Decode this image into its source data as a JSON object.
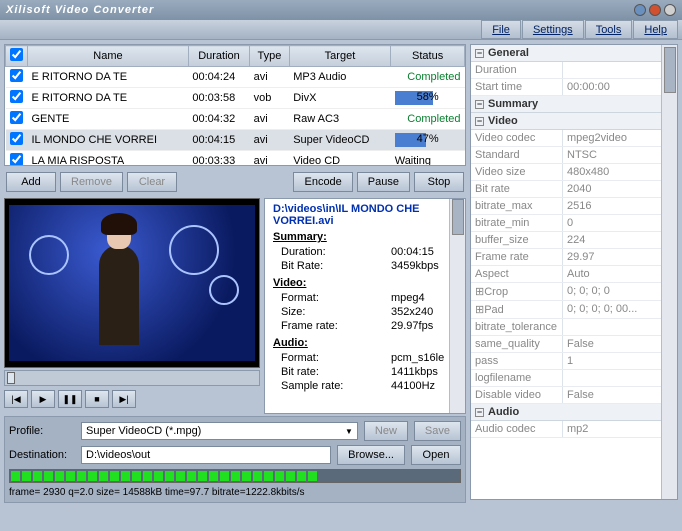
{
  "title": "Xilisoft Video Converter",
  "menu": [
    "File",
    "Settings",
    "Tools",
    "Help"
  ],
  "columns": [
    "Name",
    "Duration",
    "Type",
    "Target",
    "Status"
  ],
  "files": [
    {
      "name": "E RITORNO DA TE",
      "dur": "00:04:24",
      "type": "avi",
      "target": "MP3 Audio",
      "status": "Completed",
      "kind": "done"
    },
    {
      "name": "E RITORNO DA TE",
      "dur": "00:03:58",
      "type": "vob",
      "target": "DivX",
      "status": "58%",
      "kind": "prog",
      "pct": 58
    },
    {
      "name": "GENTE",
      "dur": "00:04:32",
      "type": "avi",
      "target": "Raw AC3",
      "status": "Completed",
      "kind": "done"
    },
    {
      "name": "IL MONDO CHE VORREI",
      "dur": "00:04:15",
      "type": "avi",
      "target": "Super VideoCD",
      "status": "47%",
      "kind": "prog",
      "pct": 47,
      "sel": true
    },
    {
      "name": "LA MIA RISPOSTA",
      "dur": "00:03:33",
      "type": "avi",
      "target": "Video CD",
      "status": "Waiting",
      "kind": "wait"
    }
  ],
  "buttons": {
    "add": "Add",
    "remove": "Remove",
    "clear": "Clear",
    "encode": "Encode",
    "pause": "Pause",
    "stop": "Stop",
    "new": "New",
    "save": "Save",
    "browse": "Browse...",
    "open": "Open"
  },
  "detail": {
    "path": "D:\\videos\\in\\IL MONDO CHE VORREI.avi",
    "summary_h": "Summary:",
    "video_h": "Video:",
    "audio_h": "Audio:",
    "rows": [
      {
        "k": "Duration:",
        "v": "00:04:15"
      },
      {
        "k": "Bit Rate:",
        "v": "3459kbps"
      }
    ],
    "vrows": [
      {
        "k": "Format:",
        "v": "mpeg4"
      },
      {
        "k": "Size:",
        "v": "352x240"
      },
      {
        "k": "Frame rate:",
        "v": "29.97fps"
      }
    ],
    "arows": [
      {
        "k": "Format:",
        "v": "pcm_s16le"
      },
      {
        "k": "Bit rate:",
        "v": "1411kbps"
      },
      {
        "k": "Sample rate:",
        "v": "44100Hz"
      }
    ]
  },
  "profile_lbl": "Profile:",
  "dest_lbl": "Destination:",
  "profile": "Super VideoCD  (*.mpg)",
  "dest": "D:\\videos\\out",
  "statusline": "frame= 2930 q=2.0 size=  14588kB time=97.7 bitrate=1222.8kbits/s",
  "progress_segments": 28,
  "props": {
    "sections": [
      {
        "title": "General",
        "rows": [
          [
            "Duration",
            ""
          ],
          [
            "Start time",
            "00:00:00"
          ]
        ]
      },
      {
        "title": "Summary",
        "rows": []
      },
      {
        "title": "Video",
        "rows": [
          [
            "Video codec",
            "mpeg2video"
          ],
          [
            "Standard",
            "NTSC"
          ],
          [
            "Video size",
            "480x480"
          ],
          [
            "Bit rate",
            "2040"
          ],
          [
            "bitrate_max",
            "2516"
          ],
          [
            "bitrate_min",
            "0"
          ],
          [
            "buffer_size",
            "224"
          ],
          [
            "Frame rate",
            "29.97"
          ],
          [
            "Aspect",
            "Auto"
          ],
          [
            "⊞Crop",
            "0; 0; 0; 0"
          ],
          [
            "⊞Pad",
            "0; 0; 0; 0; 00..."
          ],
          [
            "bitrate_tolerance",
            ""
          ],
          [
            "same_quality",
            "False"
          ],
          [
            "pass",
            "1"
          ],
          [
            "logfilename",
            ""
          ],
          [
            "Disable video",
            "False"
          ]
        ]
      },
      {
        "title": "Audio",
        "rows": [
          [
            "Audio codec",
            "mp2"
          ]
        ]
      }
    ]
  }
}
